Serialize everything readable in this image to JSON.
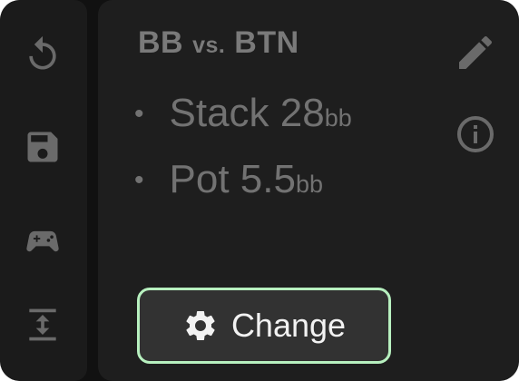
{
  "sidebar": {
    "items": [
      {
        "icon": "reset-icon"
      },
      {
        "icon": "save-icon"
      },
      {
        "icon": "gamepad-icon"
      },
      {
        "icon": "expand-vertical-icon"
      }
    ]
  },
  "panel": {
    "title_left": "BB",
    "title_vs": "vs.",
    "title_right": "BTN",
    "stats": [
      {
        "bullet": "•",
        "label": "Stack 28",
        "unit": "bb"
      },
      {
        "bullet": "•",
        "label": "Pot 5.5",
        "unit": "bb"
      }
    ],
    "edit_icon": "pencil-icon",
    "info_icon": "info-icon"
  },
  "change_button": {
    "label": "Change",
    "icon": "gear-icon"
  },
  "colors": {
    "background": "#111111",
    "sidebar": "#1b1b1b",
    "panel": "#1e1e1e",
    "muted_text": "#747474",
    "button": "#323232",
    "button_border": "#b7f0bf",
    "button_text": "#f2f2f2"
  }
}
